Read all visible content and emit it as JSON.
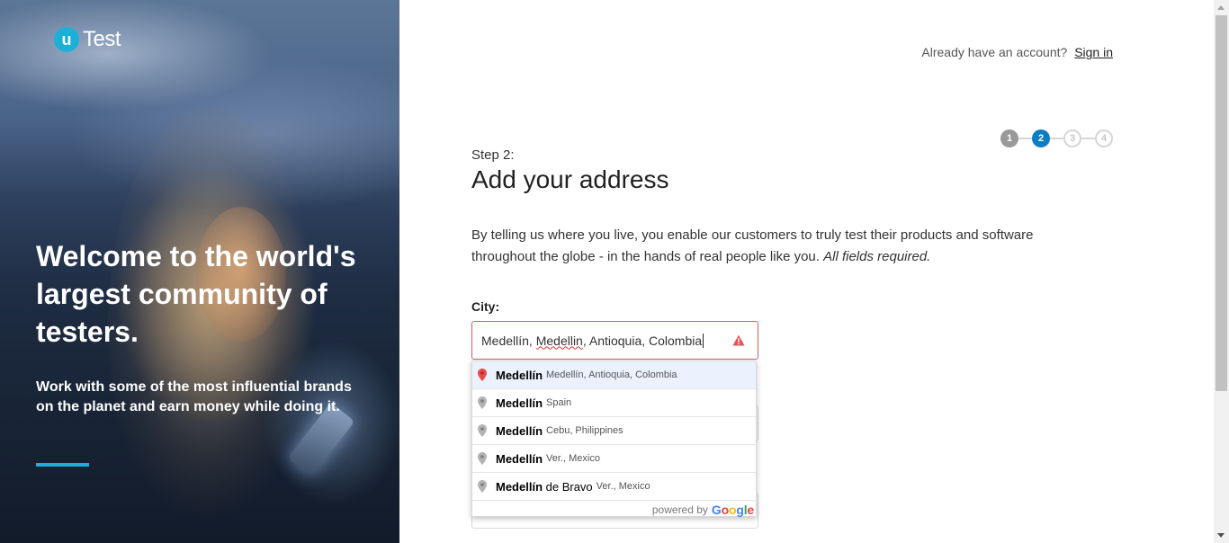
{
  "brand": {
    "logo_letter": "u",
    "logo_text": "Test"
  },
  "hero": {
    "title": "Welcome to the world's largest community of testers.",
    "subtitle": "Work with some of the most influential brands on the planet and earn money while doing it."
  },
  "header": {
    "account_prompt": "Already have an account?",
    "signin_label": "Sign in"
  },
  "stepper": {
    "steps": [
      "1",
      "2",
      "3",
      "4"
    ],
    "current": 2
  },
  "form": {
    "step_label": "Step 2:",
    "title": "Add your address",
    "intro": "By telling us where you live, you enable our customers to truly test their products and software throughout the globe - in the hands of real people like you.",
    "intro_note": "All fields required.",
    "city_label": "City:",
    "city_value_parts": [
      "Medellín, ",
      "Medellin",
      ", Antioquia, Colombia"
    ]
  },
  "autocomplete": {
    "items": [
      {
        "match": "Medellín",
        "rest": "",
        "secondary": "Medellín, Antioquia, Colombia"
      },
      {
        "match": "Medellín",
        "rest": "",
        "secondary": "Spain"
      },
      {
        "match": "Medellín",
        "rest": "",
        "secondary": "Cebu, Philippines"
      },
      {
        "match": "Medellín",
        "rest": "",
        "secondary": "Ver., Mexico"
      },
      {
        "match": "Medellín",
        "rest": " de Bravo",
        "secondary": "Ver., Mexico"
      }
    ],
    "powered_by": "powered by",
    "provider": "Google"
  },
  "colors": {
    "accent": "#0d7dc3",
    "brand_cyan": "#1ab0d8",
    "error": "#e0585a"
  }
}
